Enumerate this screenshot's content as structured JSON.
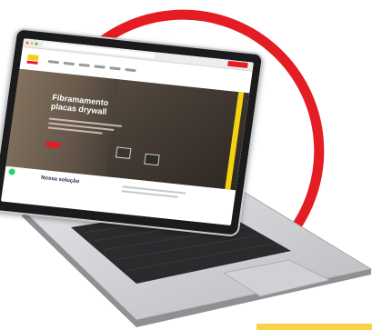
{
  "colors": {
    "accent_red": "#e31d23",
    "accent_yellow": "#f5d20f",
    "laptop_silver": "#c9cacc",
    "screen_bezel": "#1b1b1d",
    "heading_navy": "#1b2a4a"
  },
  "browser": {
    "url": ""
  },
  "hero": {
    "title": "Fibramamento\nplacas drywall"
  },
  "content": {
    "heading": "Nossa solução"
  },
  "icons": {
    "logo": "company-logo",
    "whatsapp": "whatsapp-icon"
  }
}
